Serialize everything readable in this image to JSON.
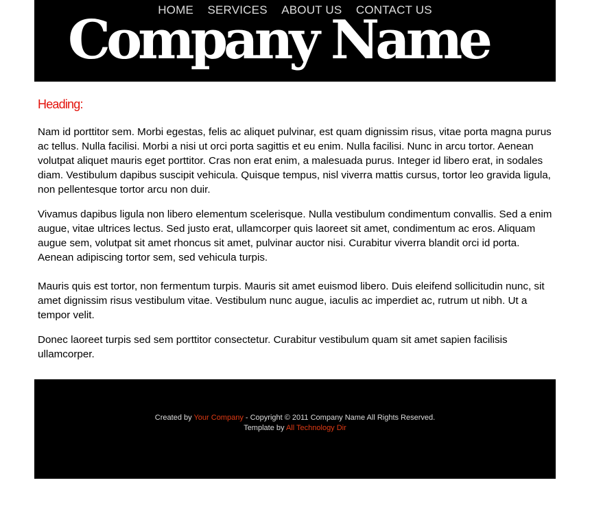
{
  "nav": {
    "items": [
      {
        "label": "HOME"
      },
      {
        "label": "SERVICES"
      },
      {
        "label": "ABOUT US"
      },
      {
        "label": "CONTACT US"
      }
    ]
  },
  "logo": {
    "text": "Company Name"
  },
  "content": {
    "heading": "Heading:",
    "paragraphs": [
      "Nam id porttitor sem. Morbi egestas, felis ac aliquet pulvinar, est quam dignissim risus, vitae porta magna purus ac tellus. Nulla facilisi. Morbi a nisi ut orci porta sagittis et eu enim. Nulla facilisi. Nunc in arcu tortor. Aenean volutpat aliquet mauris eget porttitor. Cras non erat enim, a malesuada purus. Integer id libero erat, in sodales diam. Vestibulum dapibus suscipit vehicula. Quisque tempus, nisl viverra mattis cursus, tortor leo gravida ligula, non pellentesque tortor arcu non duir.",
      "Vivamus dapibus ligula non libero elementum scelerisque. Nulla vestibulum condimentum convallis. Sed a enim augue, vitae ultrices lectus. Sed justo erat, ullamcorper quis laoreet sit amet, condimentum ac eros. Aliquam augue sem, volutpat sit amet rhoncus sit amet, pulvinar auctor nisi. Curabitur viverra blandit orci id porta. Aenean adipiscing tortor sem, sed vehicula turpis.",
      "Mauris quis est tortor, non fermentum turpis. Mauris sit amet euismod libero. Duis eleifend sollicitudin nunc, sit amet dignissim risus vestibulum vitae. Vestibulum nunc augue, iaculis ac imperdiet ac, rutrum ut nibh. Ut a tempor velit.",
      "Donec laoreet turpis sed sem porttitor consectetur. Curabitur vestibulum quam sit amet sapien facilisis ullamcorper."
    ]
  },
  "footer": {
    "created_by_prefix": "Created by ",
    "company_link": "Your Company",
    "copyright": " - Copyright © 2011 Company Name All Rights Reserved.",
    "template_prefix": "Template by ",
    "template_link": "All Technology Dir"
  },
  "colors": {
    "accent": "#e3120b",
    "link": "#e03a14",
    "header_bg": "#000000",
    "footer_bg": "#000000"
  }
}
